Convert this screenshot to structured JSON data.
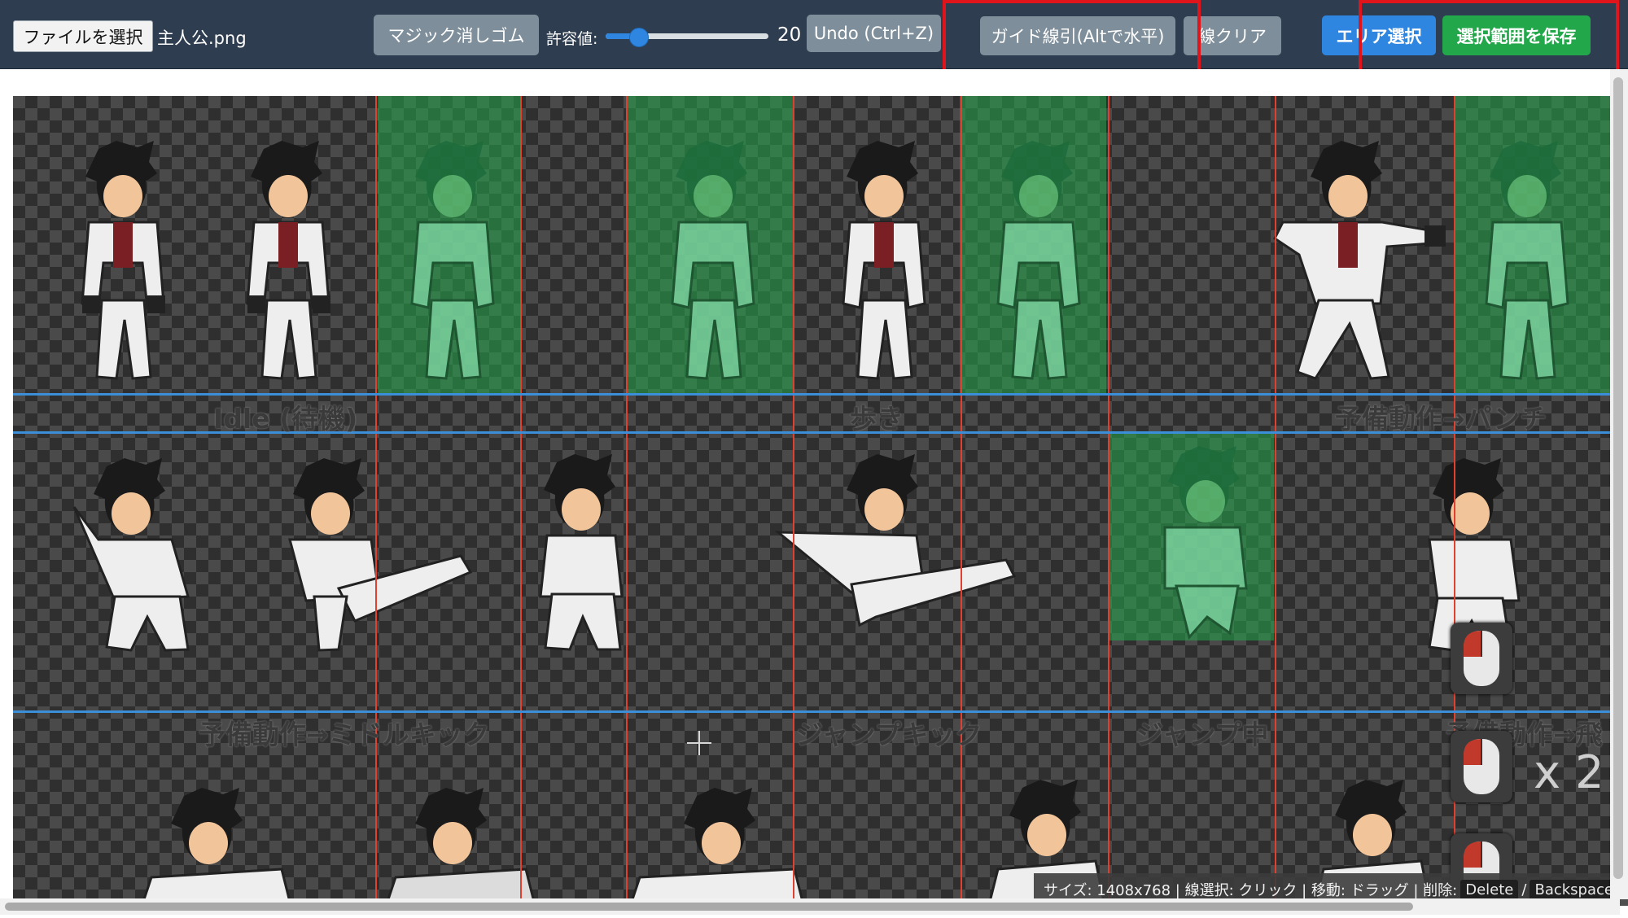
{
  "toolbar": {
    "file_button": "ファイルを選択",
    "file_name": "主人公.png",
    "magic_eraser": "マジック消しゴム",
    "tolerance_label": "許容値:",
    "tolerance_value": "20",
    "tolerance_fraction": 0.2,
    "undo": "Undo (Ctrl+Z)",
    "guide_line": "ガイド線引(Altで水平)",
    "clear_lines": "線クリア",
    "area_select": "エリア選択",
    "save_selection": "選択範囲を保存"
  },
  "canvas": {
    "labels": [
      "Idle (待機)",
      "歩き",
      "予備動作→パンチ",
      "予備動作→ミドルキック",
      "ジャンプキック",
      "ジャンプ中",
      "予備動作→飛"
    ]
  },
  "overlay": {
    "click_count": "x 2"
  },
  "status": {
    "text": "サイズ: 1408x768 | 線選択: クリック | 移動: ドラッグ | 削除:",
    "key_delete": "Delete",
    "separator": "/",
    "key_backspace": "Backspace"
  },
  "colors": {
    "toolbar_bg": "#2e3d4f",
    "primary_blue": "#2f86e0",
    "save_green": "#22a84a",
    "guide_red": "#e0402f",
    "guide_blue": "#3a8fd8",
    "highlight_red": "#e0141b"
  }
}
